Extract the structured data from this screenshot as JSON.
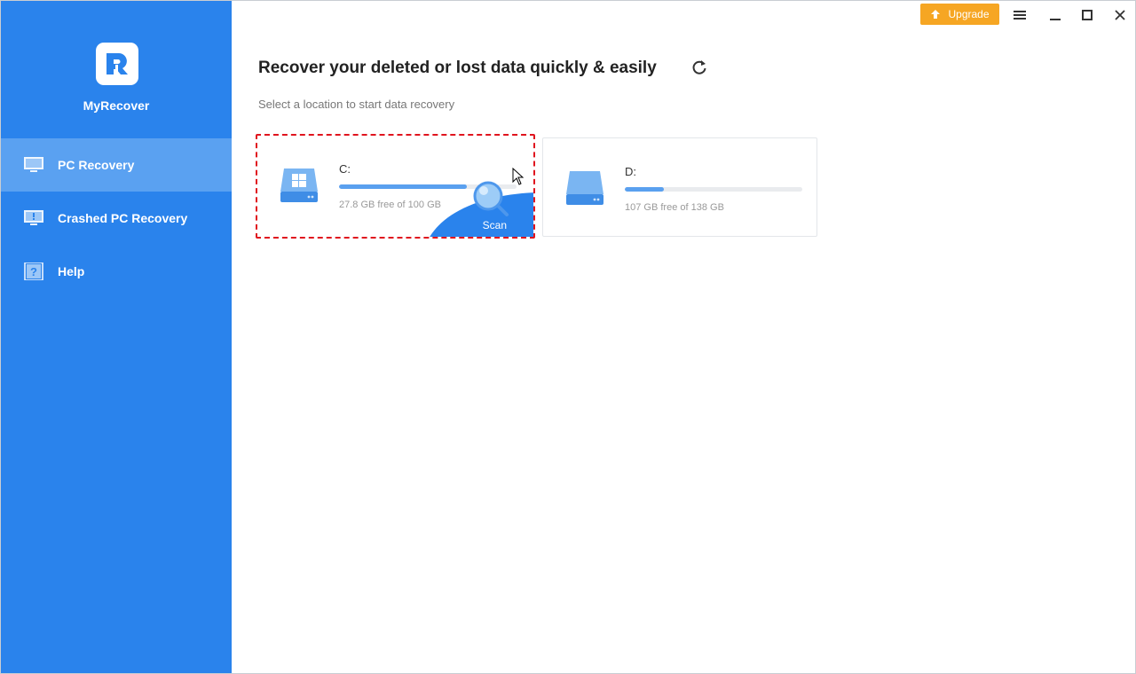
{
  "app": {
    "name": "MyRecover"
  },
  "sidebar": {
    "items": [
      {
        "label": "PC Recovery",
        "icon": "monitor-icon",
        "active": true
      },
      {
        "label": "Crashed PC Recovery",
        "icon": "crashed-monitor-icon",
        "active": false
      },
      {
        "label": "Help",
        "icon": "help-icon",
        "active": false
      }
    ]
  },
  "titlebar": {
    "upgrade_label": "Upgrade",
    "upgrade_color": "#f6a623"
  },
  "main": {
    "title": "Recover your deleted or lost data quickly & easily",
    "subtitle": "Select a location to start data recovery",
    "drives": [
      {
        "label": "C:",
        "free_text": "27.8 GB free of 100 GB",
        "used_fraction": 0.72,
        "selected": true,
        "scan_label": "Scan",
        "icon": "windows-drive-icon"
      },
      {
        "label": "D:",
        "free_text": "107 GB free of 138 GB",
        "used_fraction": 0.22,
        "selected": false,
        "icon": "drive-icon"
      }
    ]
  },
  "colors": {
    "sidebar": "#2a83ec",
    "sidebar_active": "#5aa1f1",
    "accent": "#2a83ec",
    "selection_outline": "#e0141e"
  }
}
